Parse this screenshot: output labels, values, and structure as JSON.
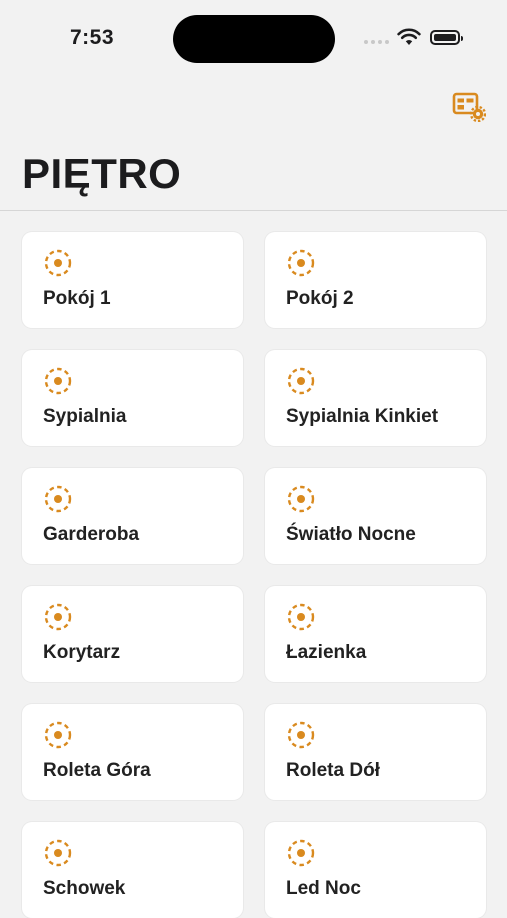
{
  "status_bar": {
    "time": "7:53",
    "icons": [
      "signal-icon",
      "wifi-icon",
      "battery-icon"
    ]
  },
  "header": {
    "title": "PIĘTRO",
    "settings_icon": "dashboard-settings-icon"
  },
  "colors": {
    "accent": "#d98a1f",
    "background": "#f2f2f2",
    "tile": "#ffffff",
    "text": "#1c1c1e"
  },
  "tiles": [
    {
      "label": "Pokój 1",
      "icon": "light-icon"
    },
    {
      "label": "Pokój 2",
      "icon": "light-icon"
    },
    {
      "label": "Sypialnia",
      "icon": "light-icon"
    },
    {
      "label": "Sypialnia Kinkiet",
      "icon": "light-icon"
    },
    {
      "label": "Garderoba",
      "icon": "light-icon"
    },
    {
      "label": "Światło Nocne",
      "icon": "light-icon"
    },
    {
      "label": "Korytarz",
      "icon": "light-icon"
    },
    {
      "label": "Łazienka",
      "icon": "light-icon"
    },
    {
      "label": "Roleta Góra",
      "icon": "light-icon"
    },
    {
      "label": "Roleta Dół",
      "icon": "light-icon"
    },
    {
      "label": "Schowek",
      "icon": "light-icon"
    },
    {
      "label": "Led Noc",
      "icon": "light-icon"
    }
  ]
}
